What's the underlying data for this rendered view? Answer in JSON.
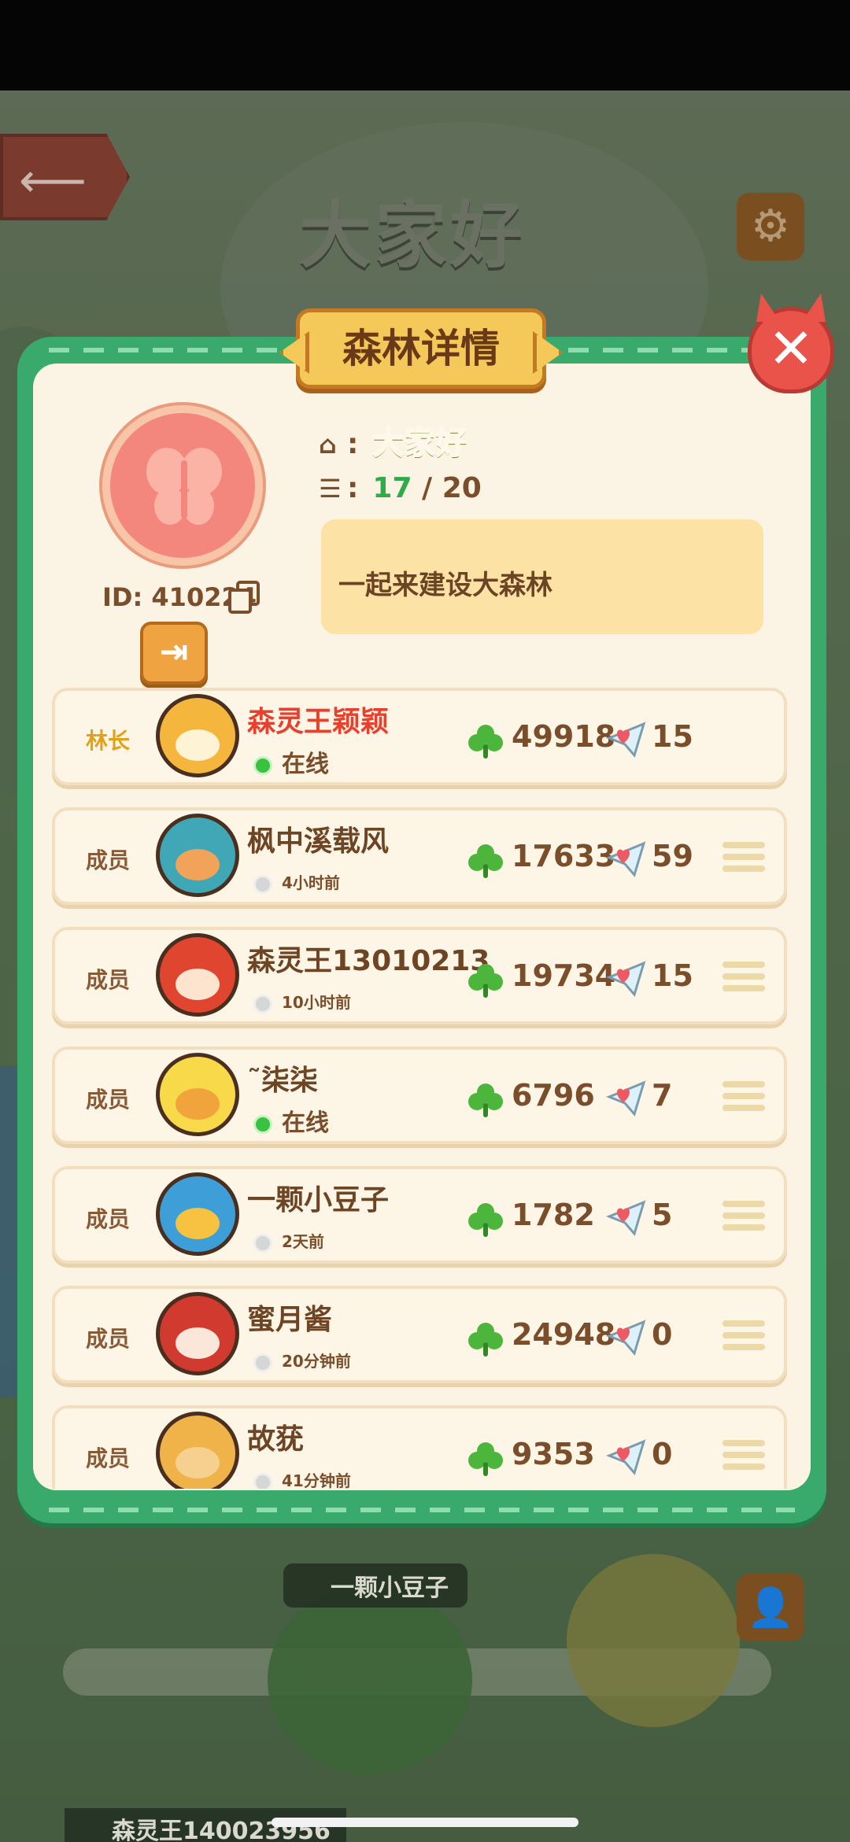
{
  "background": {
    "town_title": "大家好",
    "map_labels": [
      "一颗小豆子",
      "森灵王140023956"
    ]
  },
  "modal": {
    "title": "森林详情",
    "close_glyph": "✕"
  },
  "forest": {
    "id_label": "ID: 410224",
    "name": "大家好",
    "members_current": "17",
    "members_max": " / 20",
    "slogan": "一起来建设大森林",
    "exit_glyph": "⇥"
  },
  "icons": {
    "home": "house-icon",
    "members": "members-icon",
    "leaf": "clover-icon",
    "likes": "heart-paper-plane-icon",
    "menu": "menu-icon",
    "copy": "copy-icon",
    "exit": "exit-icon",
    "settings": "gear-icon",
    "back": "back-arrow-icon"
  },
  "colors": {
    "modal_border": "#3aaa6c",
    "panel": "#fbf4e4",
    "online": "#38c23f",
    "leader_name": "#e8402f",
    "leader_role": "#e0a21a"
  },
  "members": [
    {
      "role": "林长",
      "name": "森灵王颖颖",
      "status": "在线",
      "online": true,
      "score": "49918",
      "likes": "15"
    },
    {
      "role": "成员",
      "name": "枫中溪载风",
      "status": "4小时前",
      "online": false,
      "score": "17633",
      "likes": "59"
    },
    {
      "role": "成员",
      "name": "森灵王13010213",
      "status": "10小时前",
      "online": false,
      "score": "19734",
      "likes": "15"
    },
    {
      "role": "成员",
      "name": "˜柒柒",
      "status": "在线",
      "online": true,
      "score": "6796",
      "likes": "7"
    },
    {
      "role": "成员",
      "name": "一颗小豆子",
      "status": "2天前",
      "online": false,
      "score": "1782",
      "likes": "5"
    },
    {
      "role": "成员",
      "name": "蜜月酱",
      "status": "20分钟前",
      "online": false,
      "score": "24948",
      "likes": "0"
    },
    {
      "role": "成员",
      "name": "故莸",
      "status": "41分钟前",
      "online": false,
      "score": "9353",
      "likes": "0"
    }
  ]
}
